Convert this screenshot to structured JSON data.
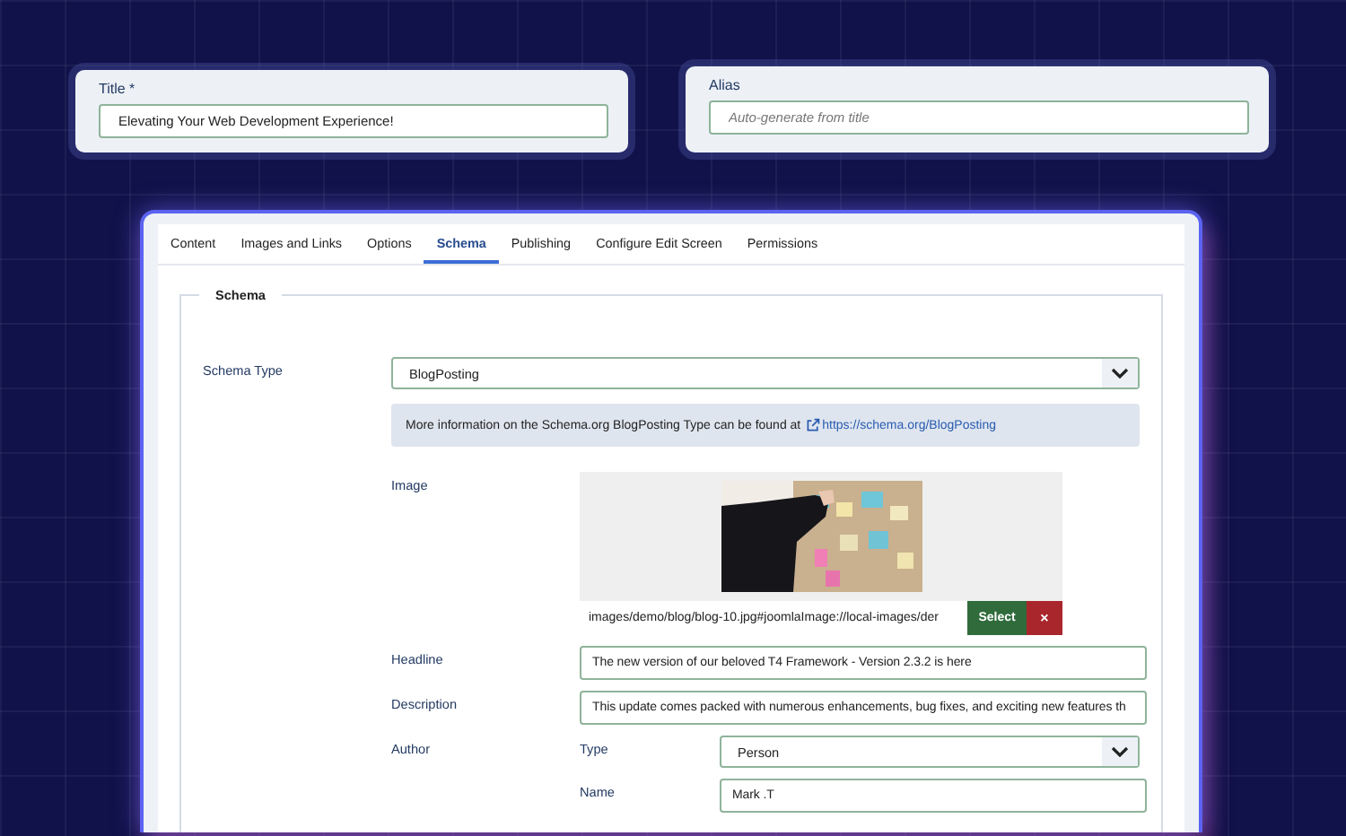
{
  "title_field": {
    "label": "Title *",
    "value": "Elevating Your Web Development Experience!"
  },
  "alias_field": {
    "label": "Alias",
    "placeholder": "Auto-generate from title"
  },
  "tabs": [
    {
      "label": "Content",
      "selected": false
    },
    {
      "label": "Images and Links",
      "selected": false
    },
    {
      "label": "Options",
      "selected": false
    },
    {
      "label": "Schema",
      "selected": true
    },
    {
      "label": "Publishing",
      "selected": false
    },
    {
      "label": "Configure Edit Screen",
      "selected": false
    },
    {
      "label": "Permissions",
      "selected": false
    }
  ],
  "fieldset": {
    "legend": "Schema",
    "schema_type": {
      "label": "Schema Type",
      "value": "BlogPosting"
    },
    "info": {
      "text": "More information on the Schema.org BlogPosting Type can be found at",
      "link": "https://schema.org/BlogPosting"
    },
    "image": {
      "label": "Image",
      "path": "images/demo/blog/blog-10.jpg#joomlaImage://local-images/der",
      "select_button": "Select",
      "clear_button": "×"
    },
    "headline": {
      "label": "Headline",
      "value": "The new version of our beloved T4 Framework - Version 2.3.2 is here"
    },
    "description": {
      "label": "Description",
      "value": "This update comes packed with numerous enhancements, bug fixes, and exciting new features th"
    },
    "author": {
      "label": "Author",
      "type": {
        "label": "Type",
        "value": "Person"
      },
      "name": {
        "label": "Name",
        "value": "Mark .T"
      }
    }
  }
}
